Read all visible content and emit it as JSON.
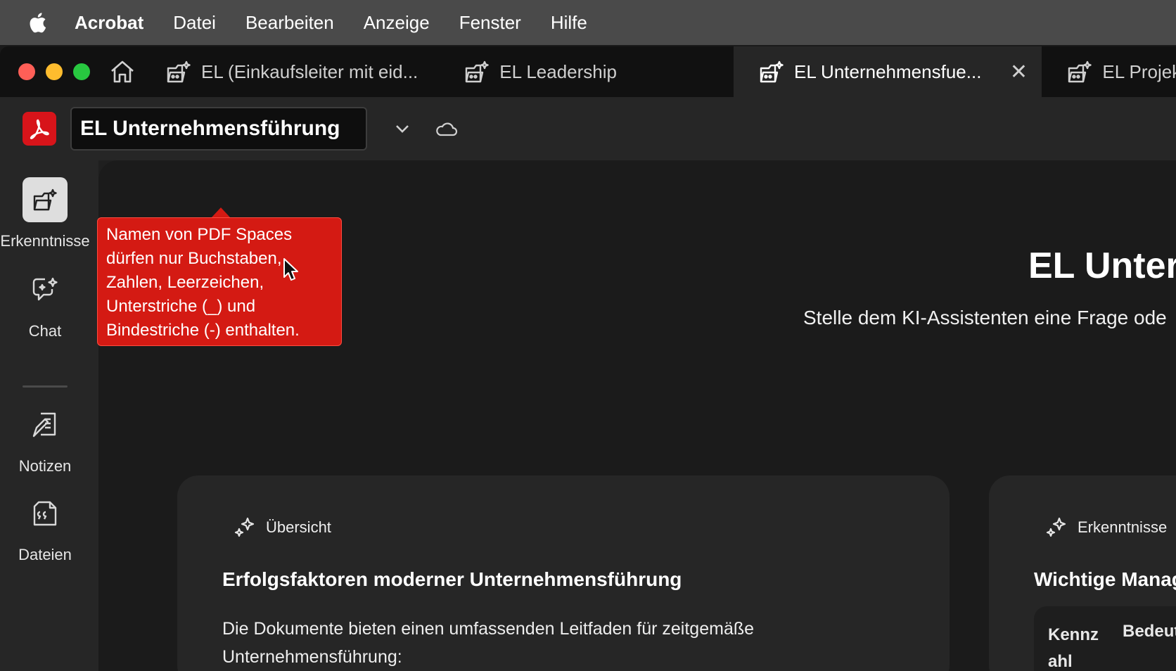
{
  "menubar": {
    "app": "Acrobat",
    "items": [
      "Datei",
      "Bearbeiten",
      "Anzeige",
      "Fenster",
      "Hilfe"
    ]
  },
  "tabs": [
    {
      "label": "EL (Einkaufsleiter mit eid...",
      "icon": "pdf-space-icon",
      "active": false
    },
    {
      "label": "EL Leadership",
      "icon": "pdf-space-icon",
      "active": false
    },
    {
      "label": "EL Unternehmensfue...",
      "icon": "pdf-space-icon",
      "active": true
    },
    {
      "label": "EL Projek",
      "icon": "pdf-space-icon",
      "active": false
    }
  ],
  "toolbar": {
    "space_name_value": "EL Unternehmensführung"
  },
  "tooltip": {
    "text": "Namen von PDF Spaces dürfen nur Buchstaben, Zahlen, Leerzeichen, Unterstriche (_) und Bindestriche (-) enthalten."
  },
  "sidebar": {
    "items": [
      {
        "label": "Erkenntnisse",
        "icon": "insights-icon",
        "active": true
      },
      {
        "label": "Chat",
        "icon": "chat-icon",
        "active": false
      },
      {
        "label": "Notizen",
        "icon": "notes-icon",
        "active": false
      },
      {
        "label": "Dateien",
        "icon": "files-icon",
        "active": false
      }
    ]
  },
  "main": {
    "title": "EL Unter",
    "subtitle": "Stelle dem KI-Assistenten eine Frage ode",
    "cards": [
      {
        "header": "Übersicht",
        "title": "Erfolgsfaktoren moderner Unternehmensführung",
        "body": "Die Dokumente bieten einen umfassenden Leitfaden für zeitgemäße Unternehmensführung:"
      },
      {
        "header": "Erkenntnisse",
        "title": "Wichtige Manag",
        "table_col1": "Kennz ahl",
        "table_col2": "Bedeut"
      }
    ]
  },
  "colors": {
    "accent_red": "#d41a13",
    "traffic_close": "#ff5f57",
    "traffic_min": "#febc2e",
    "traffic_max": "#28c840"
  }
}
